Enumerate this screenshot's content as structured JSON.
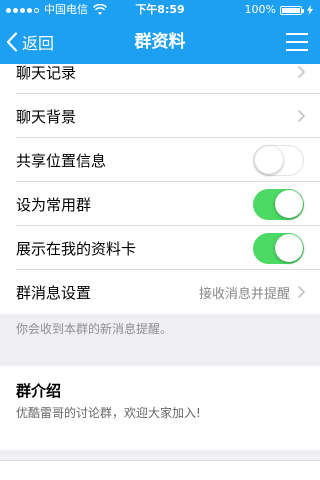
{
  "status_bar": {
    "carrier": "中国电信",
    "time": "下午8:59",
    "battery": "100%",
    "signal_bars": 5,
    "signal_filled": 4
  },
  "nav": {
    "back_label": "返回",
    "title": "群资料",
    "menu_icon": "hamburger-menu-icon"
  },
  "settings": {
    "chat_history": "聊天记录",
    "chat_background": "聊天背景",
    "share_location": {
      "label": "共享位置信息",
      "on": false
    },
    "set_common_group": {
      "label": "设为常用群",
      "on": true
    },
    "show_on_profile": {
      "label": "展示在我的资料卡",
      "on": true
    },
    "message_settings": {
      "label": "群消息设置",
      "value": "接收消息并提醒"
    },
    "message_note": "你会收到本群的新消息提醒。"
  },
  "group_intro": {
    "title": "群介绍",
    "description": "优酷雷哥的讨论群，欢迎大家加入!"
  },
  "colors": {
    "brand_blue": "#1ea0f2",
    "switch_on": "#4cd964",
    "background": "#efeff4"
  }
}
